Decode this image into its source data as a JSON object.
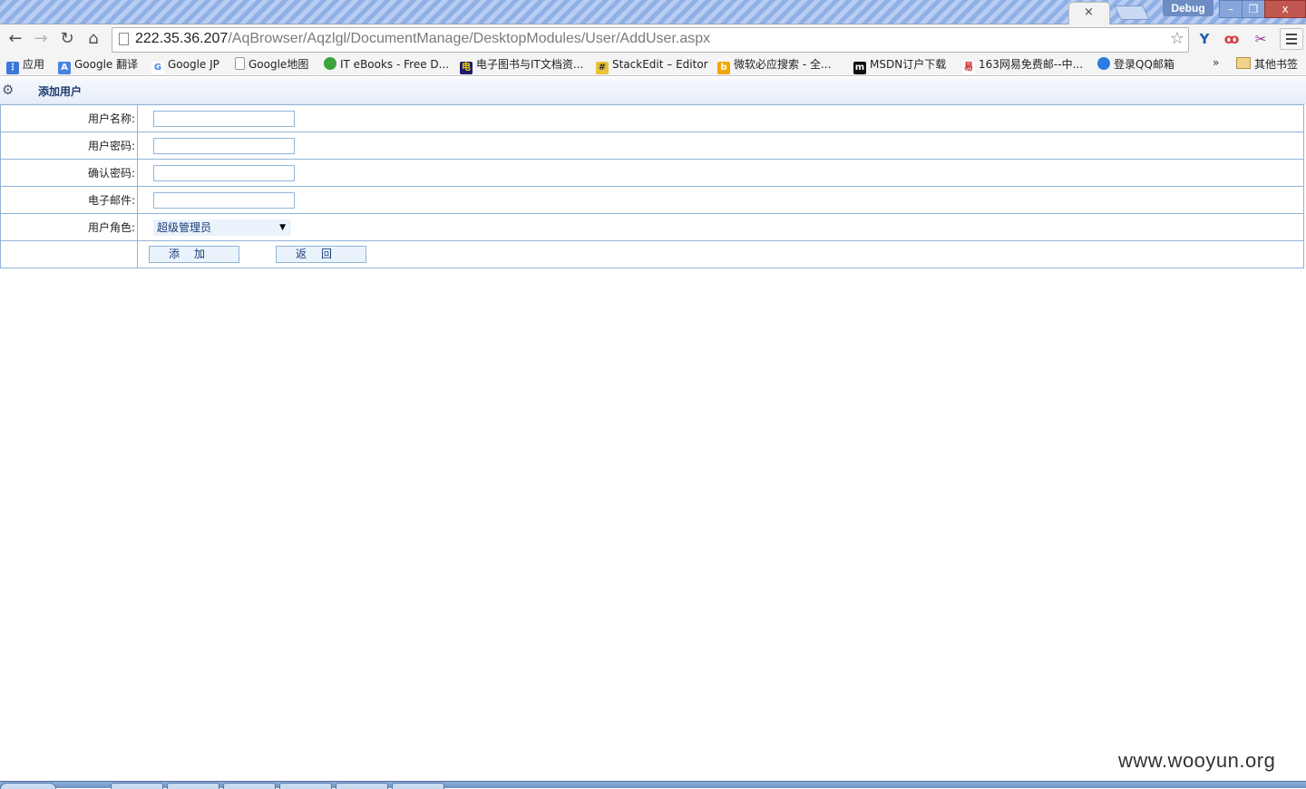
{
  "browser": {
    "window_label": "Debug",
    "tab_close_glyph": "×",
    "url_host": "222.35.36.207",
    "url_path": "/AqBrowser/Aqzlgl/DocumentManage/DesktopModules/User/AddUser.aspx",
    "bookmarks": [
      {
        "label": "应用",
        "icon": "apps-grid-icon",
        "color": "#3a78d8"
      },
      {
        "label": "Google 翻译",
        "icon": "google-translate-icon",
        "color": "#4a82e0"
      },
      {
        "label": "Google JP",
        "icon": "google-icon",
        "color": "#4285f4"
      },
      {
        "label": "Google地图",
        "icon": "page-icon",
        "color": "#ffffff"
      },
      {
        "label": "IT eBooks - Free D...",
        "icon": "itebooks-icon",
        "color": "#3aa43a"
      },
      {
        "label": "电子图书与IT文档资...",
        "icon": "ebook-icon",
        "color": "#1c1c6e"
      },
      {
        "label": "StackEdit – Editor",
        "icon": "stackedit-icon",
        "color": "#e8c23c"
      },
      {
        "label": "微软必应搜索 - 全...",
        "icon": "bing-icon",
        "color": "#f0a800"
      },
      {
        "label": "MSDN订户下载",
        "icon": "msdn-icon",
        "color": "#111111"
      },
      {
        "label": "163网易免费邮--中...",
        "icon": "netease-icon",
        "color": "#cc2222"
      },
      {
        "label": "登录QQ邮箱",
        "icon": "qqmail-icon",
        "color": "#2b7be0"
      }
    ],
    "bookmarks_overflow": "»",
    "other_bookmarks": "其他书签"
  },
  "page": {
    "title": "添加用户",
    "fields": [
      {
        "label": "用户名称:",
        "value": ""
      },
      {
        "label": "用户密码:",
        "value": ""
      },
      {
        "label": "确认密码:",
        "value": ""
      },
      {
        "label": "电子邮件:",
        "value": ""
      }
    ],
    "role_label": "用户角色:",
    "role_selected": "超级管理员",
    "add_button": "添加",
    "back_button": "返回"
  },
  "watermark": "www.wooyun.org",
  "colors": {
    "border": "#8fb4d8",
    "title": "#1d3b6e",
    "button_bg": "#eaf3fb"
  }
}
